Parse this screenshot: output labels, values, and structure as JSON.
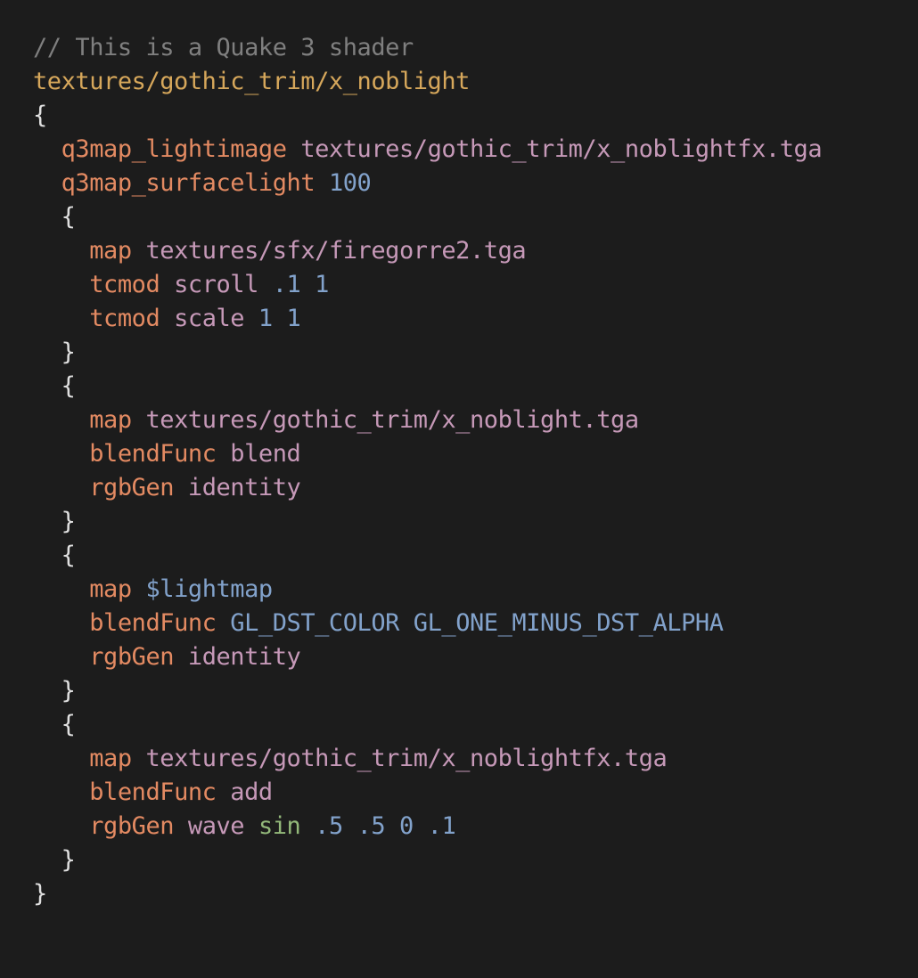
{
  "editor": {
    "colors": {
      "background": "#1c1c1c",
      "comment": "#7f7f7f",
      "shader_name": "#d6a75b",
      "brace": "#e0e0e0",
      "keyword": "#e38a62",
      "path": "#c699b8",
      "number": "#82a2cb",
      "variable": "#82a2cb",
      "function": "#93b97a",
      "plain": "#d4d4d4"
    },
    "lines": [
      {
        "indent": 0,
        "tokens": [
          {
            "text": "// This is a Quake 3 shader",
            "kind": "comment"
          }
        ]
      },
      {
        "indent": 0,
        "tokens": [
          {
            "text": "textures/gothic_trim/x_noblight",
            "kind": "shader_name"
          }
        ]
      },
      {
        "indent": 0,
        "tokens": [
          {
            "text": "{",
            "kind": "brace"
          }
        ]
      },
      {
        "indent": 1,
        "tokens": [
          {
            "text": "q3map_lightimage",
            "kind": "keyword"
          },
          {
            "text": " ",
            "kind": "plain"
          },
          {
            "text": "textures/gothic_trim/x_noblightfx.tga",
            "kind": "path"
          }
        ]
      },
      {
        "indent": 1,
        "tokens": [
          {
            "text": "q3map_surfacelight",
            "kind": "keyword"
          },
          {
            "text": " ",
            "kind": "plain"
          },
          {
            "text": "100",
            "kind": "number"
          }
        ]
      },
      {
        "indent": 1,
        "tokens": [
          {
            "text": "{",
            "kind": "brace"
          }
        ]
      },
      {
        "indent": 2,
        "tokens": [
          {
            "text": "map",
            "kind": "keyword"
          },
          {
            "text": " ",
            "kind": "plain"
          },
          {
            "text": "textures/sfx/firegorre2.tga",
            "kind": "path"
          }
        ]
      },
      {
        "indent": 2,
        "tokens": [
          {
            "text": "tcmod",
            "kind": "keyword"
          },
          {
            "text": " ",
            "kind": "plain"
          },
          {
            "text": "scroll",
            "kind": "path"
          },
          {
            "text": " ",
            "kind": "plain"
          },
          {
            "text": ".1",
            "kind": "number"
          },
          {
            "text": " ",
            "kind": "plain"
          },
          {
            "text": "1",
            "kind": "number"
          }
        ]
      },
      {
        "indent": 2,
        "tokens": [
          {
            "text": "tcmod",
            "kind": "keyword"
          },
          {
            "text": " ",
            "kind": "plain"
          },
          {
            "text": "scale",
            "kind": "path"
          },
          {
            "text": " ",
            "kind": "plain"
          },
          {
            "text": "1",
            "kind": "number"
          },
          {
            "text": " ",
            "kind": "plain"
          },
          {
            "text": "1",
            "kind": "number"
          }
        ]
      },
      {
        "indent": 1,
        "tokens": [
          {
            "text": "}",
            "kind": "brace"
          }
        ]
      },
      {
        "indent": 1,
        "tokens": [
          {
            "text": "{",
            "kind": "brace"
          }
        ]
      },
      {
        "indent": 2,
        "tokens": [
          {
            "text": "map",
            "kind": "keyword"
          },
          {
            "text": " ",
            "kind": "plain"
          },
          {
            "text": "textures/gothic_trim/x_noblight.tga",
            "kind": "path"
          }
        ]
      },
      {
        "indent": 2,
        "tokens": [
          {
            "text": "blendFunc",
            "kind": "keyword"
          },
          {
            "text": " ",
            "kind": "plain"
          },
          {
            "text": "blend",
            "kind": "path"
          }
        ]
      },
      {
        "indent": 2,
        "tokens": [
          {
            "text": "rgbGen",
            "kind": "keyword"
          },
          {
            "text": " ",
            "kind": "plain"
          },
          {
            "text": "identity",
            "kind": "path"
          }
        ]
      },
      {
        "indent": 1,
        "tokens": [
          {
            "text": "}",
            "kind": "brace"
          }
        ]
      },
      {
        "indent": 1,
        "tokens": [
          {
            "text": "{",
            "kind": "brace"
          }
        ]
      },
      {
        "indent": 2,
        "tokens": [
          {
            "text": "map",
            "kind": "keyword"
          },
          {
            "text": " ",
            "kind": "plain"
          },
          {
            "text": "$lightmap",
            "kind": "variable"
          }
        ]
      },
      {
        "indent": 2,
        "tokens": [
          {
            "text": "blendFunc",
            "kind": "keyword"
          },
          {
            "text": " ",
            "kind": "plain"
          },
          {
            "text": "GL_DST_COLOR",
            "kind": "variable"
          },
          {
            "text": " ",
            "kind": "plain"
          },
          {
            "text": "GL_ONE_MINUS_DST_ALPHA",
            "kind": "variable"
          }
        ]
      },
      {
        "indent": 2,
        "tokens": [
          {
            "text": "rgbGen",
            "kind": "keyword"
          },
          {
            "text": " ",
            "kind": "plain"
          },
          {
            "text": "identity",
            "kind": "path"
          }
        ]
      },
      {
        "indent": 1,
        "tokens": [
          {
            "text": "}",
            "kind": "brace"
          }
        ]
      },
      {
        "indent": 1,
        "tokens": [
          {
            "text": "{",
            "kind": "brace"
          }
        ]
      },
      {
        "indent": 2,
        "tokens": [
          {
            "text": "map",
            "kind": "keyword"
          },
          {
            "text": " ",
            "kind": "plain"
          },
          {
            "text": "textures/gothic_trim/x_noblightfx.tga",
            "kind": "path"
          }
        ]
      },
      {
        "indent": 2,
        "tokens": [
          {
            "text": "blendFunc",
            "kind": "keyword"
          },
          {
            "text": " ",
            "kind": "plain"
          },
          {
            "text": "add",
            "kind": "path"
          }
        ]
      },
      {
        "indent": 2,
        "tokens": [
          {
            "text": "rgbGen",
            "kind": "keyword"
          },
          {
            "text": " ",
            "kind": "plain"
          },
          {
            "text": "wave",
            "kind": "path"
          },
          {
            "text": " ",
            "kind": "plain"
          },
          {
            "text": "sin",
            "kind": "function"
          },
          {
            "text": " ",
            "kind": "plain"
          },
          {
            "text": ".5",
            "kind": "number"
          },
          {
            "text": " ",
            "kind": "plain"
          },
          {
            "text": ".5",
            "kind": "number"
          },
          {
            "text": " ",
            "kind": "plain"
          },
          {
            "text": "0",
            "kind": "number"
          },
          {
            "text": " ",
            "kind": "plain"
          },
          {
            "text": ".1",
            "kind": "number"
          }
        ]
      },
      {
        "indent": 1,
        "tokens": [
          {
            "text": "}",
            "kind": "brace"
          }
        ]
      },
      {
        "indent": 0,
        "tokens": [
          {
            "text": "}",
            "kind": "brace"
          }
        ]
      }
    ]
  }
}
